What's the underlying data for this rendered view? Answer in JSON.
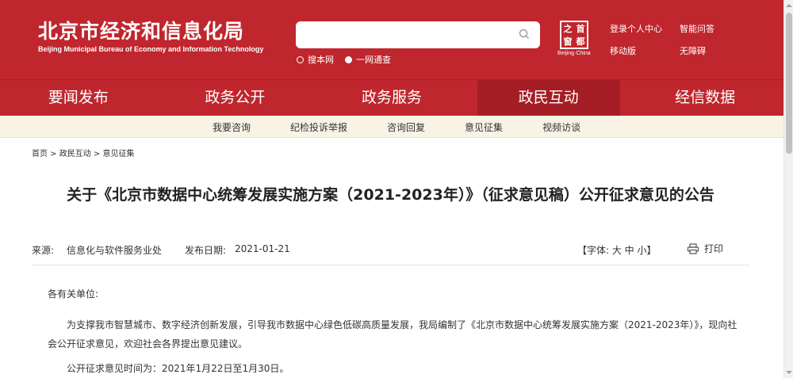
{
  "header": {
    "logo_cn": "北京市经济和信息化局",
    "logo_en": "Beijing Municipal Bureau of Economy and Information Technology",
    "search_placeholder": "",
    "search_options": [
      "搜本网",
      "一网通查"
    ],
    "seal_chars": [
      "之",
      "首",
      "窗",
      "都"
    ],
    "seal_en": "Beijing·China",
    "top_links": [
      "登录个人中心",
      "智能问答",
      "移动版",
      "无障碍"
    ]
  },
  "nav": {
    "items": [
      "要闻发布",
      "政务公开",
      "政务服务",
      "政民互动",
      "经信数据"
    ],
    "active": "政民互动"
  },
  "subnav": {
    "items": [
      "我要咨询",
      "纪检投诉举报",
      "咨询回复",
      "意见征集",
      "视频访谈"
    ]
  },
  "breadcrumb": "首页 > 政民互动 > 意见征集",
  "article": {
    "title": "关于《北京市数据中心统筹发展实施方案（2021-2023年）》（征求意见稿）公开征求意见的公告",
    "source_label": "来源:",
    "source": "信息化与软件服务业处",
    "date_label": "发布日期:",
    "date": "2021-01-21",
    "font_size_label": "【字体:  大  中  小】",
    "print_label": "打印",
    "salutation": "各有关单位:",
    "paragraph1": "为支撑我市智慧城市、数字经济创新发展，引导我市数据中心绿色低碳高质量发展，我局编制了《北京市数据中心统筹发展实施方案（2021-2023年）》，现向社会公开征求意见，欢迎社会各界提出意见建议。",
    "paragraph2": "公开征求意见时间为：2021年1月22日至1月30日。"
  },
  "colors": {
    "brand_red": "#c0262d",
    "subnav_bg": "#f9f3e6"
  }
}
